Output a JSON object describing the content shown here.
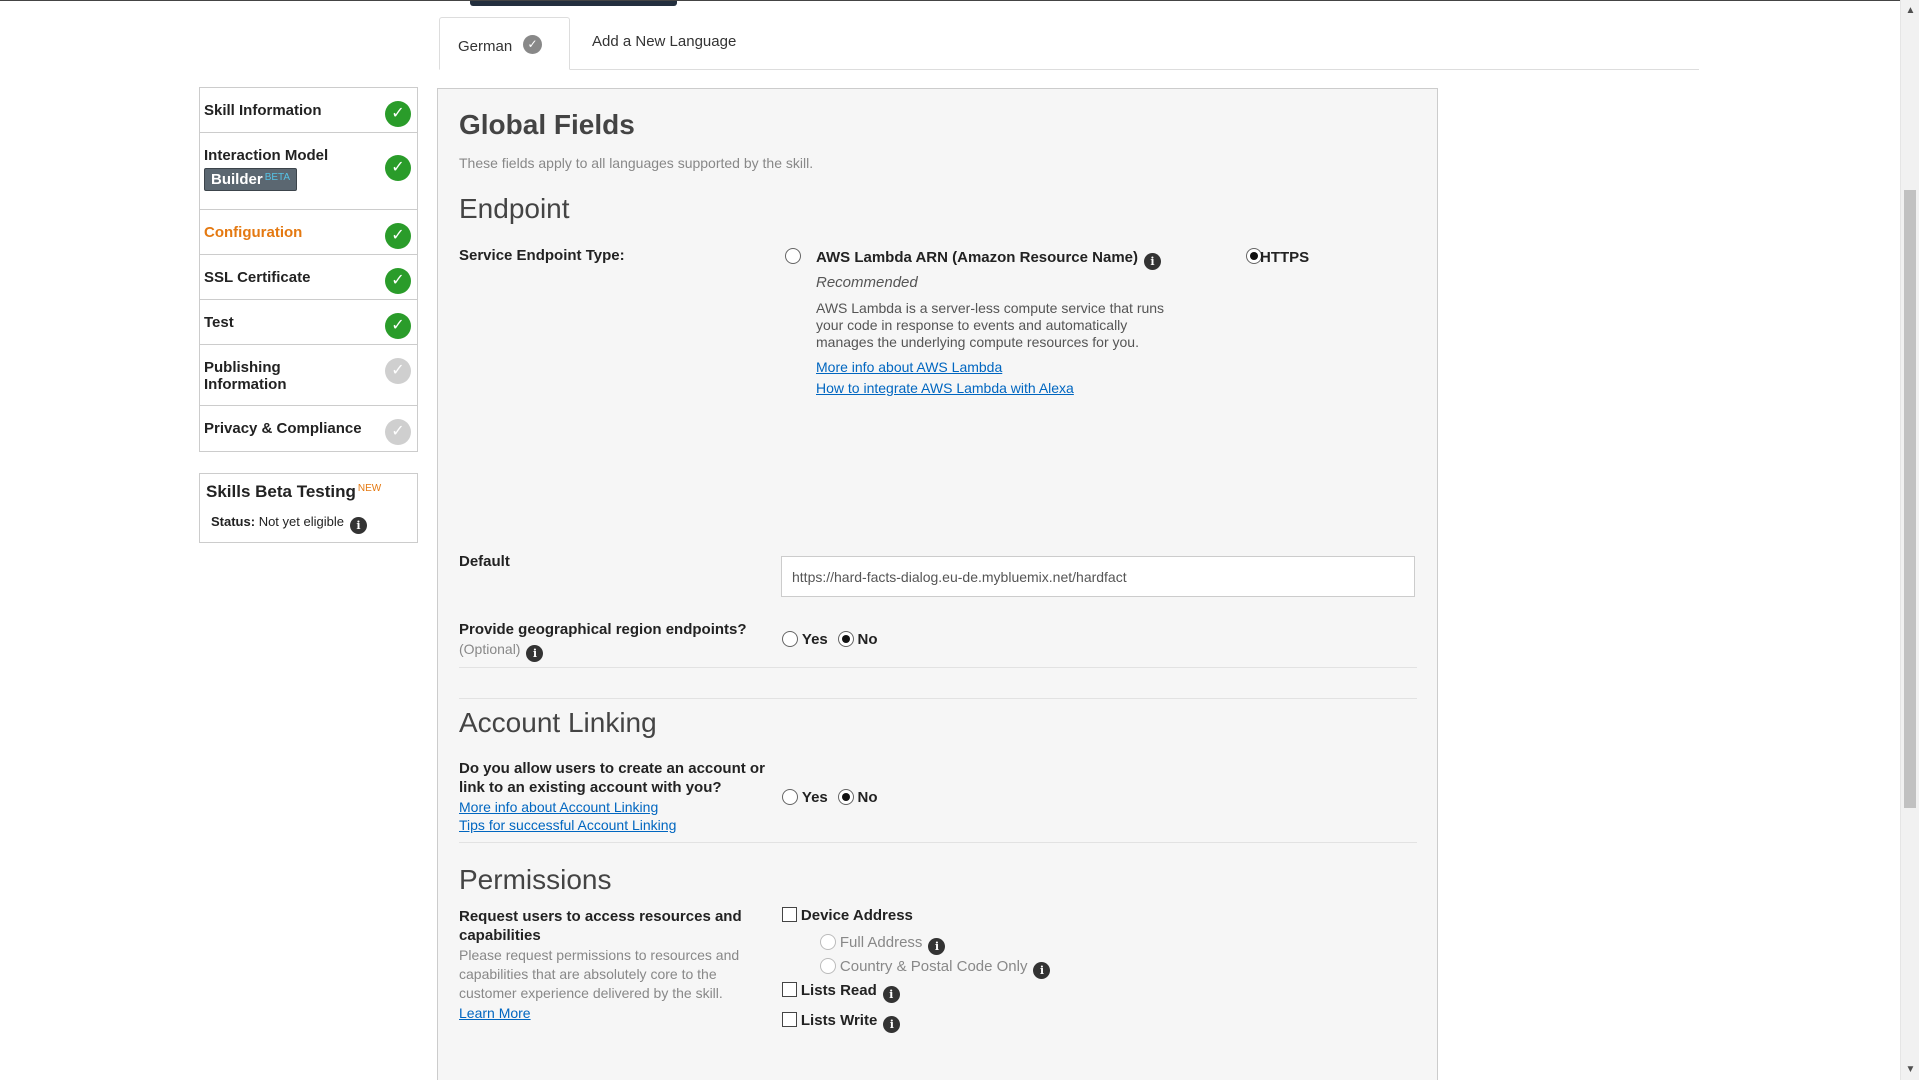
{
  "tabs": {
    "active_label": "German",
    "add_label": "Add a New Language"
  },
  "sidebar": {
    "items": [
      {
        "label": "Skill Information",
        "status": "complete"
      },
      {
        "label": "Interaction Model",
        "badge": "Builder",
        "badge_tag": "BETA",
        "status": "complete"
      },
      {
        "label": "Configuration",
        "status": "complete",
        "active": true
      },
      {
        "label": "SSL Certificate",
        "status": "complete"
      },
      {
        "label": "Test",
        "status": "complete"
      },
      {
        "label": "Publishing Information",
        "status": "pending"
      },
      {
        "label": "Privacy & Compliance",
        "status": "pending"
      }
    ],
    "beta_testing": {
      "title": "Skills Beta Testing",
      "new_tag": "NEW",
      "status_label": "Status:",
      "status_value": "Not yet eligible"
    }
  },
  "main": {
    "title": "Global Fields",
    "subtitle": "These fields apply to all languages supported by the skill.",
    "endpoint": {
      "heading": "Endpoint",
      "type_label": "Service Endpoint Type:",
      "lambda_label": "AWS Lambda ARN (Amazon Resource Name)",
      "lambda_recommended": "Recommended",
      "lambda_desc": "AWS Lambda is a server-less compute service that runs your code in response to events and automatically manages the underlying compute resources for you.",
      "lambda_link1": "More info about AWS Lambda",
      "lambda_link2": "How to integrate AWS Lambda with Alexa",
      "https_label": "HTTPS",
      "selected": "HTTPS",
      "default_label": "Default",
      "default_value": "https://hard-facts-dialog.eu-de.mybluemix.net/hardfact",
      "geo_label": "Provide geographical region endpoints?",
      "geo_optional": "(Optional)",
      "yes": "Yes",
      "no": "No",
      "geo_selected": "No"
    },
    "account_linking": {
      "heading": "Account Linking",
      "question": "Do you allow users to create an account or link to an existing account with you?",
      "link1": "More info about Account Linking",
      "link2": "Tips for successful Account Linking",
      "yes": "Yes",
      "no": "No",
      "selected": "No"
    },
    "permissions": {
      "heading": "Permissions",
      "label": "Request users to access resources and capabilities",
      "desc": "Please request permissions to resources and capabilities that are absolutely core to the customer experience delivered by the skill.",
      "learn_more": "Learn More",
      "device_address": "Device Address",
      "full_address": "Full Address",
      "country_postal": "Country & Postal Code Only",
      "lists_read": "Lists Read",
      "lists_write": "Lists Write"
    }
  },
  "colors": {
    "accent": "#e47911",
    "complete": "#2a9c2a",
    "pending": "#cfcfcf",
    "link": "#0066c0"
  }
}
